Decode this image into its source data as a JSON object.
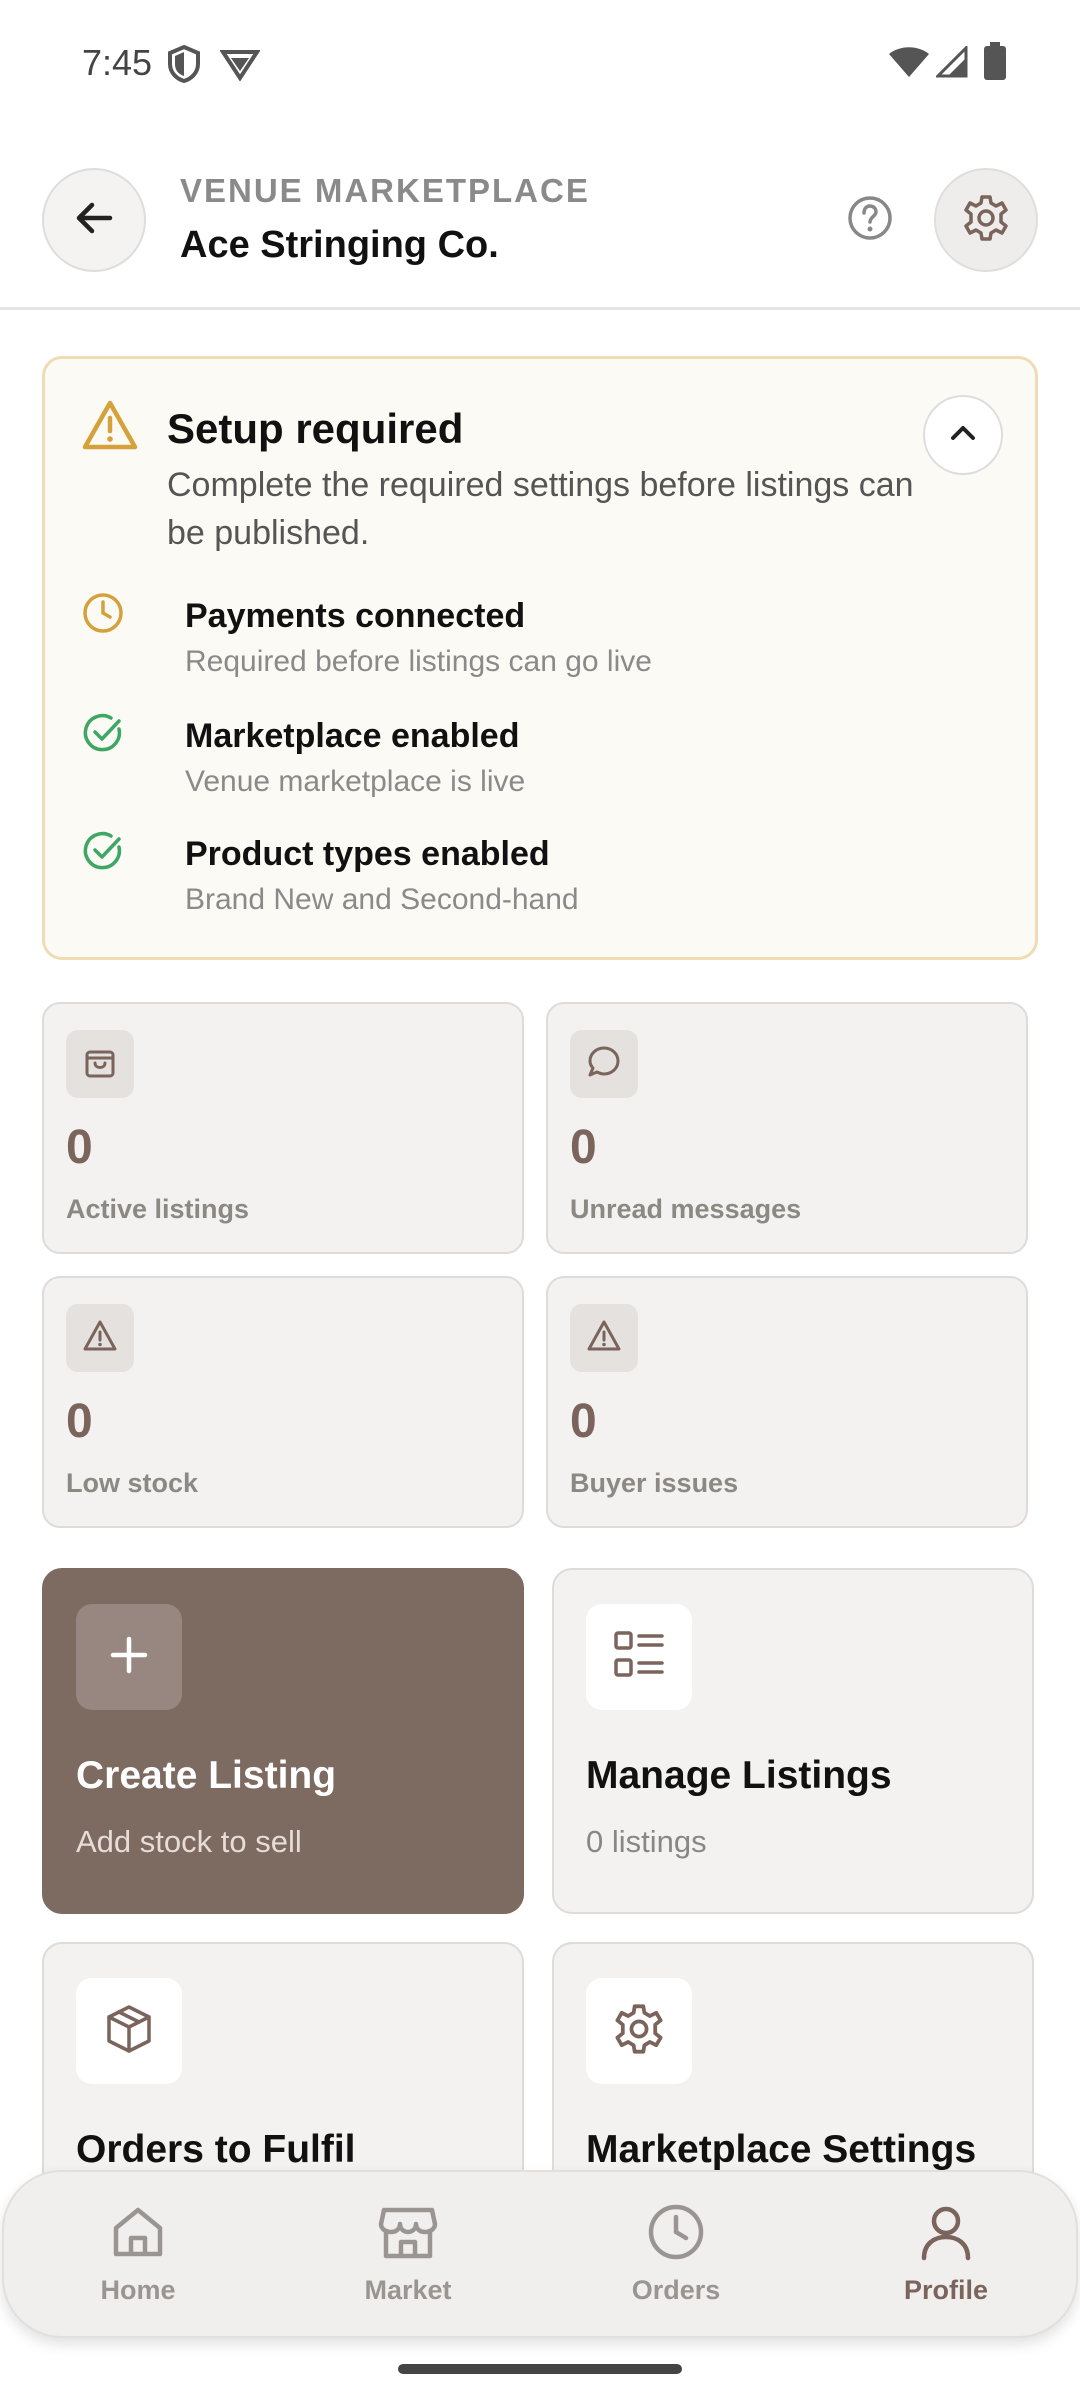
{
  "status_bar": {
    "time": "7:45",
    "icons_left": [
      "shield-icon",
      "vpn-icon"
    ],
    "icons_right": [
      "wifi-icon",
      "signal-icon",
      "battery-icon"
    ]
  },
  "header": {
    "eyebrow": "VENUE MARKETPLACE",
    "title": "Ace Stringing Co.",
    "back_icon": "arrow-left-icon",
    "help_icon": "help-circle-icon",
    "settings_icon": "gear-icon"
  },
  "setup": {
    "title": "Setup required",
    "description": "Complete the required settings before listings can be published.",
    "items": [
      {
        "title": "Payments connected",
        "subtitle": "Required before listings can go live",
        "status": "pending",
        "icon": "clock-icon"
      },
      {
        "title": "Marketplace enabled",
        "subtitle": "Venue marketplace is live",
        "status": "done",
        "icon": "check-circle-icon"
      },
      {
        "title": "Product types enabled",
        "subtitle": "Brand New and Second-hand",
        "status": "done",
        "icon": "check-circle-icon"
      }
    ]
  },
  "stats": [
    {
      "value": "0",
      "label": "Active listings",
      "icon": "shopping-bag-icon"
    },
    {
      "value": "0",
      "label": "Unread messages",
      "icon": "message-icon"
    },
    {
      "value": "0",
      "label": "Low stock",
      "icon": "warning-icon"
    },
    {
      "value": "0",
      "label": "Buyer issues",
      "icon": "warning-icon"
    }
  ],
  "actions": [
    {
      "title": "Create Listing",
      "subtitle": "Add stock to sell",
      "icon": "plus-icon"
    },
    {
      "title": "Manage Listings",
      "subtitle": "0 listings",
      "icon": "list-icon"
    },
    {
      "title": "Orders to Fulfil",
      "subtitle": "",
      "icon": "package-icon"
    },
    {
      "title": "Marketplace Settings",
      "subtitle": "",
      "icon": "gear-icon"
    }
  ],
  "nav": [
    {
      "label": "Home",
      "icon": "home-icon"
    },
    {
      "label": "Market",
      "icon": "store-icon"
    },
    {
      "label": "Orders",
      "icon": "clock-icon"
    },
    {
      "label": "Profile",
      "icon": "user-icon",
      "active": true
    }
  ],
  "colors": {
    "accent": "#7d6a60",
    "warning": "#d4a13a",
    "success": "#3fa765"
  }
}
